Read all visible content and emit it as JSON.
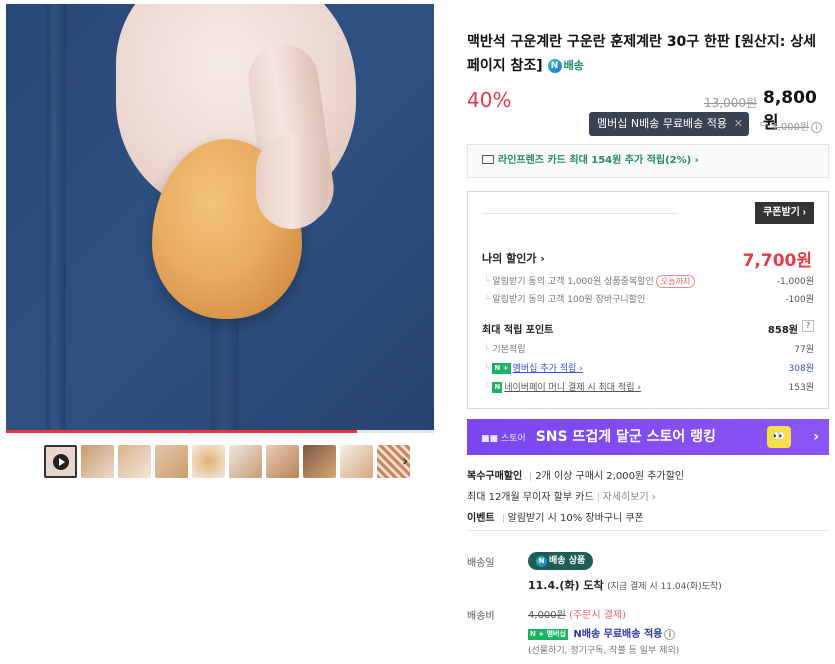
{
  "product": {
    "title": "맥반석 구운계란 구운란 훈제계란 30구 한판 [원산지: 상세페이지 참조]",
    "delivery_badge": "배송",
    "discount_rate": "40%",
    "original_price": "13,000원",
    "sale_price": "8,800원"
  },
  "tooltip": {
    "text": "멤버십 N배송 무료배송 적용",
    "close": "✕"
  },
  "shipping_strike": {
    "prefix": "ᄆ",
    "value": "4,000원"
  },
  "card_promo": {
    "text": "라인프렌즈 카드 최대 154원 추가 적립(2%) ›"
  },
  "coupon": {
    "button_label": "쿠폰받기 ›",
    "my_price_label": "나의 할인가 ›",
    "my_price": "7,700원",
    "discounts": [
      {
        "label": "알림받기 동의 고객 1,000원 상품중복할인",
        "tag": "오늘까지",
        "value": "-1,000원"
      },
      {
        "label": "알림받기 동의 고객 100원 장바구니할인",
        "value": "-100원"
      }
    ],
    "points_label": "최대 적립 포인트",
    "points_value": "858원",
    "points_help": "?",
    "points": [
      {
        "label": "기본적립",
        "value": "77원"
      },
      {
        "badge": "N +",
        "label": "멤버십 추가 적립 ›",
        "value": "308원"
      },
      {
        "badge": "N",
        "label": "네이버페이 머니 결제 시 최대 적립 ›",
        "value": "153원"
      }
    ]
  },
  "banner": {
    "store_label": "■■ 스토어",
    "text": "SNS 뜨겁게 달군 스토어 랭킹",
    "eyes": "👀",
    "chevron": "›"
  },
  "benefits": {
    "multi": {
      "label": "복수구매할인",
      "text": "2개 이상 구매시 2,000원 추가할인"
    },
    "card": {
      "label": "최대 12개월 무이자 할부 카드",
      "more": "자세히보기 ›"
    },
    "event": {
      "label": "이벤트",
      "text": "알림받기 시 10% 장바구니 쿠폰"
    }
  },
  "shipping": {
    "date_label": "배송일",
    "badge": "배송 상품",
    "arrival_date": "11.4.(화) 도착",
    "arrival_note": "(지금 결제 시 11.04(화)도착)",
    "fee_label": "배송비",
    "fee_original": "4,000원",
    "fee_cod": "(주문시 결제)",
    "member_badge": "N + 멤버십",
    "member_free": "N배송 무료배송 적용",
    "note": "(선물하기, 정기구독, 작불 등 일부 제외)"
  },
  "gallery": {
    "thumb_count": 10,
    "next": "›",
    "progress": 0.82
  }
}
